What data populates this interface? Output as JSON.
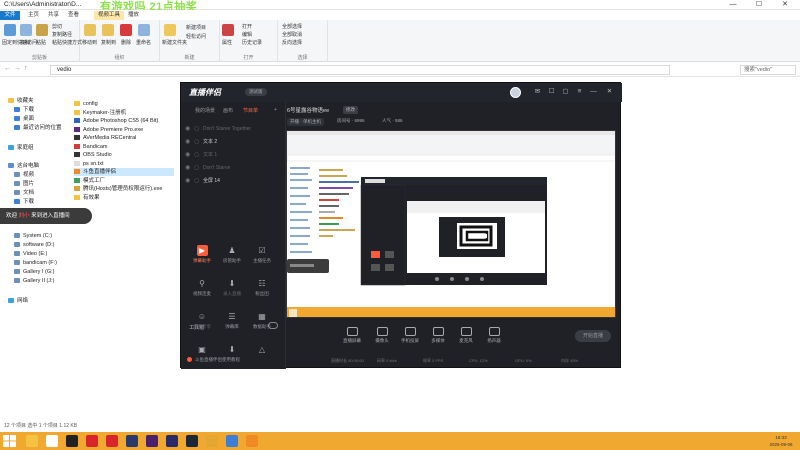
{
  "explorer": {
    "path_title": "C:\\Users\\Administrator\\D...",
    "overlay_title": "有游戏吗  21点抽奖",
    "window_controls": {
      "minimize": "—",
      "maximize": "☐",
      "close": "✕"
    },
    "ribbon_tabs": [
      "文件",
      "主页",
      "共享",
      "查看",
      "视频工具",
      "播放"
    ],
    "ribbon_groups": {
      "clipboard": "剪贴板",
      "organize": "组织",
      "new": "新建",
      "open": "打开",
      "select": "选择"
    },
    "ribbon_buttons": {
      "pin": "固定到快速访问",
      "copy": "复制",
      "paste": "粘贴",
      "cut": "剪切",
      "copy_path": "复制路径",
      "paste_shortcut": "粘贴快捷方式",
      "move_to": "移动到",
      "copy_to": "复制到",
      "delete": "删除",
      "rename": "重命名",
      "new_folder": "新建文件夹",
      "new_item": "新建项目",
      "easy_access": "轻松访问",
      "properties": "属性",
      "open_btn": "打开",
      "edit": "编辑",
      "history": "历史记录",
      "select_all": "全部选择",
      "select_none": "全部取消",
      "invert": "反向选择"
    },
    "address": "vedio",
    "search_placeholder": "搜索\"vedio\"",
    "nav_items": [
      {
        "label": "收藏夹",
        "color": "#f5c342"
      },
      {
        "label": "下载",
        "color": "#3d7fd6"
      },
      {
        "label": "桌面",
        "color": "#3d7fd6"
      },
      {
        "label": "最近访问的位置",
        "color": "#3d7fd6"
      },
      {
        "label": "家庭组",
        "color": "#3aa3d9"
      },
      {
        "label": "这台电脑",
        "color": "#5b8fd4"
      },
      {
        "label": "视频",
        "color": "#6d8fb8"
      },
      {
        "label": "图片",
        "color": "#6d8fb8"
      },
      {
        "label": "文档",
        "color": "#6d8fb8"
      },
      {
        "label": "下载",
        "color": "#3d7fd6"
      },
      {
        "label": "System (C:)",
        "color": "#6d8fb8"
      },
      {
        "label": "software (D:)",
        "color": "#6d8fb8"
      },
      {
        "label": "Video (E:)",
        "color": "#6d8fb8"
      },
      {
        "label": "bandicam (F:)",
        "color": "#6d8fb8"
      },
      {
        "label": "Gallery I (G:)",
        "color": "#6d8fb8"
      },
      {
        "label": "Gallery II (J:)",
        "color": "#6d8fb8"
      },
      {
        "label": "网络",
        "color": "#3aa3d9"
      }
    ],
    "files": [
      {
        "name": "config",
        "color": "#f5c342"
      },
      {
        "name": "Keymaker-注册机",
        "color": "#f5c342"
      },
      {
        "name": "Adobe Photoshop CS5 (64 Bit)",
        "color": "#2a67b7"
      },
      {
        "name": "Adobe Premiere Pro.exe",
        "color": "#5b2a86"
      },
      {
        "name": "AVerMedia RECentral",
        "color": "#333333"
      },
      {
        "name": "Bandicam",
        "color": "#d63a3a"
      },
      {
        "name": "OBS Studio",
        "color": "#333333"
      },
      {
        "name": "ps sn.txt",
        "color": "#dddddd"
      },
      {
        "name": "斗鱼直播伴侣",
        "color": "#f08a24"
      },
      {
        "name": "模式工厂",
        "color": "#3aa35b"
      },
      {
        "name": "腾讯(Hosts)管理员权限运行).exe",
        "color": "#d6a33a"
      },
      {
        "name": "有效果",
        "color": "#f5c342"
      }
    ],
    "status": "12 个项目    选中 1 个项目  1.12 KB"
  },
  "toast": {
    "prefix": "欢迎",
    "highlight": "刘小",
    "suffix": "来到进入直播间"
  },
  "app": {
    "logo": "直播伴侣",
    "version": "测试版",
    "header_icons": [
      "mail-icon",
      "chat-icon",
      "camera-icon",
      "settings-icon",
      "bell-icon",
      "menu-icon",
      "minimize-icon",
      "close-icon"
    ],
    "scene_tabs": [
      "我的场景",
      "画布",
      "节目单",
      "+"
    ],
    "sources": [
      {
        "label": "Don't Starve Together",
        "active": false
      },
      {
        "label": "文本 2",
        "active": true
      },
      {
        "label": "文本 1",
        "active": false
      },
      {
        "label": "Don't Starve",
        "active": false
      },
      {
        "label": "全屏 14",
        "active": true
      }
    ],
    "tools_label": "工具箱",
    "tools": [
      {
        "label": "弹幕助手",
        "hot": true,
        "glyph": "▶"
      },
      {
        "label": "房管助手",
        "hot": false,
        "glyph": "♟"
      },
      {
        "label": "主播任务",
        "hot": false,
        "glyph": "☑"
      },
      {
        "label": "视频连麦",
        "hot": false,
        "glyph": "⚲"
      },
      {
        "label": "录入直播",
        "hot": false,
        "glyph": "⬇",
        "dim": true
      },
      {
        "label": "粉丝团",
        "hot": false,
        "glyph": "☷"
      },
      {
        "label": "超管专享",
        "hot": false,
        "glyph": "☺",
        "dim": true
      },
      {
        "label": "弹幕库",
        "hot": false,
        "glyph": "☰"
      },
      {
        "label": "数据助手",
        "hot": false,
        "glyph": "▦"
      },
      {
        "label": "",
        "hot": false,
        "glyph": "▣"
      },
      {
        "label": "",
        "hot": false,
        "glyph": "⬇"
      },
      {
        "label": "",
        "hot": false,
        "glyph": "△"
      }
    ],
    "bottom_notice": "斗鱼直播伴侣使用教程",
    "room_title": "6号星露谷物语ee",
    "edit_tag": "修改",
    "meta": [
      "开播 · 单机主机",
      "房间号 · 6996",
      "人气 · 586"
    ],
    "bottom_buttons": [
      "直播屏幕",
      "摄像头",
      "手机投屏",
      "多媒体",
      "麦克风",
      "扬声器"
    ],
    "start_label": "开始直播",
    "statusbar": [
      "直播时长 00:00:00",
      "码率 0 kb/s",
      "帧率 0 FPS",
      "CPU: 12%",
      "GPU: 0%",
      "内存 45%"
    ]
  },
  "taskbar": {
    "icons": [
      {
        "name": "file-explorer-icon",
        "color": "#f5c342"
      },
      {
        "name": "browser-icon",
        "color": "#ffffff"
      },
      {
        "name": "qq-icon",
        "color": "#222222"
      },
      {
        "name": "netease-music-icon",
        "color": "#d6262c"
      },
      {
        "name": "record-icon",
        "color": "#d6262c"
      },
      {
        "name": "photoshop-icon",
        "color": "#2a3a6b"
      },
      {
        "name": "premiere-icon",
        "color": "#4a1f6b"
      },
      {
        "name": "after-effects-icon",
        "color": "#2a2a6b"
      },
      {
        "name": "steam-icon",
        "color": "#1b2838"
      },
      {
        "name": "chrome-icon",
        "color": "#e4a733"
      },
      {
        "name": "tool-icon",
        "color": "#3d7fd6"
      },
      {
        "name": "douyu-icon",
        "color": "#f08a24"
      }
    ],
    "time": "18:33",
    "date": "2025-09-06"
  }
}
